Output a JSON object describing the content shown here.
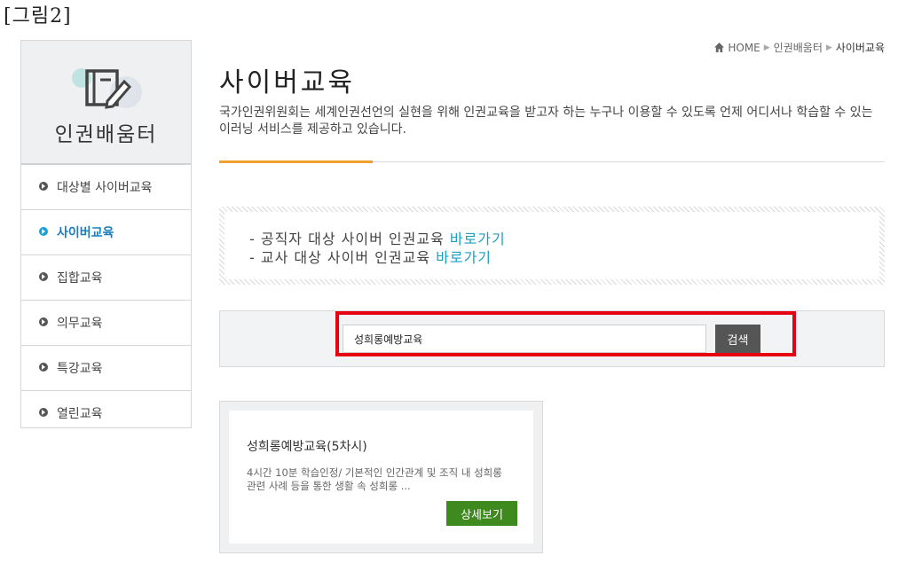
{
  "figure_caption": "[그림2]",
  "sidebar": {
    "title": "인권배움터",
    "items": [
      {
        "label": "대상별 사이버교육",
        "active": false
      },
      {
        "label": "사이버교육",
        "active": true
      },
      {
        "label": "집합교육",
        "active": false
      },
      {
        "label": "의무교육",
        "active": false
      },
      {
        "label": "특강교육",
        "active": false
      },
      {
        "label": "열린교육",
        "active": false
      }
    ]
  },
  "breadcrumb": {
    "home": "HOME",
    "level1": "인권배움터",
    "current": "사이버교육"
  },
  "page": {
    "title": "사이버교육",
    "description": "국가인권위원회는 세계인권선언의 실현을 위해 인권교육을 받고자 하는 누구나 이용할 수 있도록 언제 어디서나 학습할 수 있는 이러닝 서비스를 제공하고 있습니다."
  },
  "links": [
    {
      "text": "- 공직자 대상 사이버 인권교육 ",
      "link": "바로가기"
    },
    {
      "text": "- 교사 대상 사이버 인권교육 ",
      "link": "바로가기"
    }
  ],
  "search": {
    "value": "성희롱예방교육",
    "button": "검색"
  },
  "course": {
    "title": "성희롱예방교육(5차시)",
    "description": "4시간 10분 학습인정/ 기본적인 인간관계 및 조직 내 성희롱 관련 사례 등을 통한 생활 속 성희롱 ...",
    "button": "상세보기"
  },
  "colors": {
    "accent_orange": "#f0a030",
    "link_blue": "#1a9fc0",
    "active_blue": "#1a7fbf",
    "detail_green": "#3f8a1e",
    "highlight_red": "#e60012"
  }
}
